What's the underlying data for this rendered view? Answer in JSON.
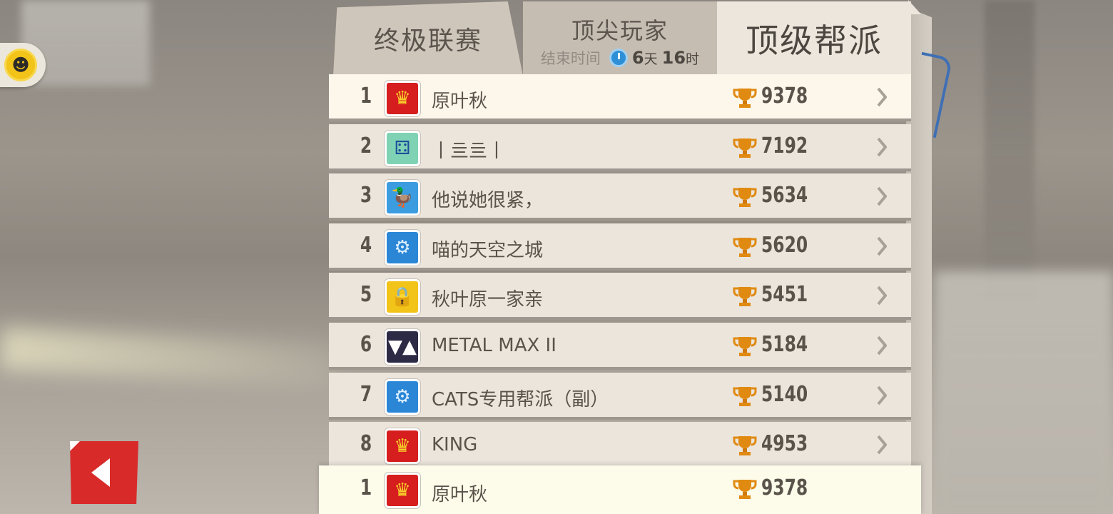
{
  "tabs": [
    {
      "label": "终极联赛"
    },
    {
      "label": "顶尖玩家",
      "sub_label": "结束时间",
      "days": "6",
      "days_unit": "天",
      "hours": "16",
      "hours_unit": "时"
    },
    {
      "label": "顶级帮派"
    }
  ],
  "rows": [
    {
      "rank": "1",
      "name": "原叶秋",
      "score": "9378",
      "emblem": "crown"
    },
    {
      "rank": "2",
      "name": "丨亖亖丨",
      "score": "7192",
      "emblem": "dice"
    },
    {
      "rank": "3",
      "name": "他说她很紧，",
      "score": "5634",
      "emblem": "duck"
    },
    {
      "rank": "4",
      "name": "喵的天空之城",
      "score": "5620",
      "emblem": "gear"
    },
    {
      "rank": "5",
      "name": "秋叶原一家亲",
      "score": "5451",
      "emblem": "lock"
    },
    {
      "rank": "6",
      "name": "METAL MAX II",
      "score": "5184",
      "emblem": "monster"
    },
    {
      "rank": "7",
      "name": "CATS专用帮派（副）",
      "score": "5140",
      "emblem": "gear"
    },
    {
      "rank": "8",
      "name": "KING",
      "score": "4953",
      "emblem": "crown"
    }
  ],
  "my_row": {
    "rank": "1",
    "name": "原叶秋",
    "score": "9378",
    "emblem": "crown"
  },
  "colors": {
    "accent_red": "#d92a2a",
    "trophy": "#e08a12",
    "row_bg": "#ece5dc",
    "highlight_bg": "#fdf6ea"
  }
}
